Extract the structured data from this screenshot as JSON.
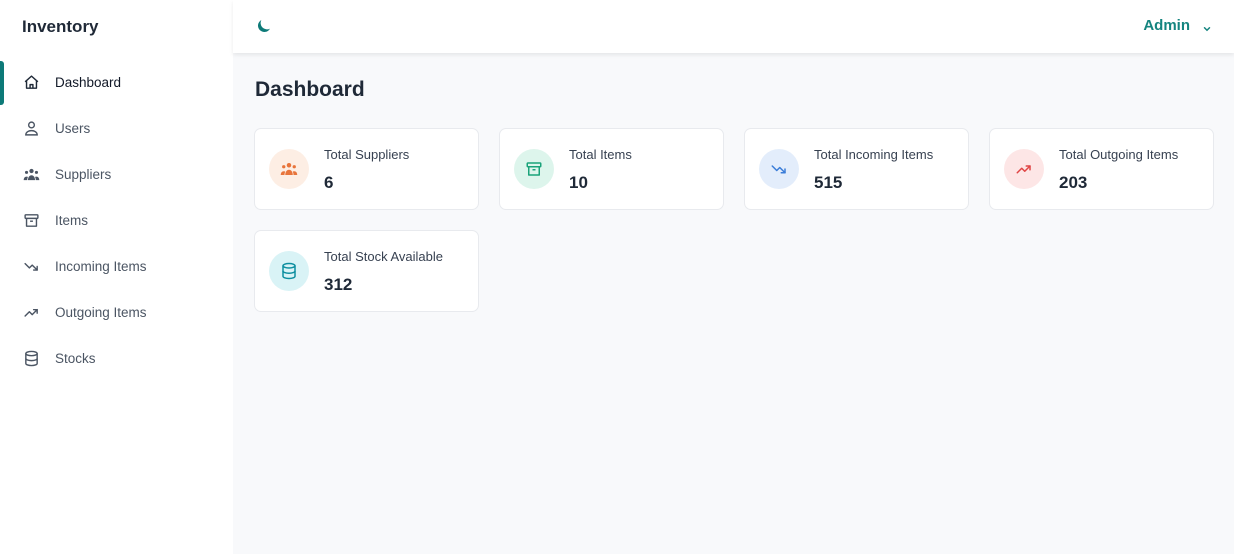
{
  "sidebar": {
    "brand": "Inventory",
    "items": [
      {
        "label": "Dashboard",
        "icon": "home-icon"
      },
      {
        "label": "Users",
        "icon": "user-icon"
      },
      {
        "label": "Suppliers",
        "icon": "users-group-icon"
      },
      {
        "label": "Items",
        "icon": "archive-box-icon"
      },
      {
        "label": "Incoming Items",
        "icon": "trend-down-icon"
      },
      {
        "label": "Outgoing Items",
        "icon": "trend-up-icon"
      },
      {
        "label": "Stocks",
        "icon": "database-icon"
      }
    ]
  },
  "header": {
    "theme_icon": "moon-icon",
    "user_name": "Admin",
    "user_menu_icon": "chevron-down-icon"
  },
  "main": {
    "title": "Dashboard",
    "cards": [
      {
        "label": "Total Suppliers",
        "value": "6",
        "icon": "users-group-icon",
        "color": "#e8743b",
        "bg": "#fdeee4"
      },
      {
        "label": "Total Items",
        "value": "10",
        "icon": "archive-box-icon",
        "color": "#1aa37a",
        "bg": "#ddf5ec"
      },
      {
        "label": "Total Incoming Items",
        "value": "515",
        "icon": "trend-down-icon",
        "color": "#3b7dd8",
        "bg": "#e3edfb"
      },
      {
        "label": "Total Outgoing Items",
        "value": "203",
        "icon": "trend-up-icon",
        "color": "#e04545",
        "bg": "#fde6e6"
      },
      {
        "label": "Total Stock Available",
        "value": "312",
        "icon": "database-icon",
        "color": "#0e8fa0",
        "bg": "#d9f3f6"
      }
    ]
  },
  "colors": {
    "accent": "#0d7a78",
    "sidebar_bg": "#ffffff",
    "content_bg": "#f8f9fb"
  }
}
